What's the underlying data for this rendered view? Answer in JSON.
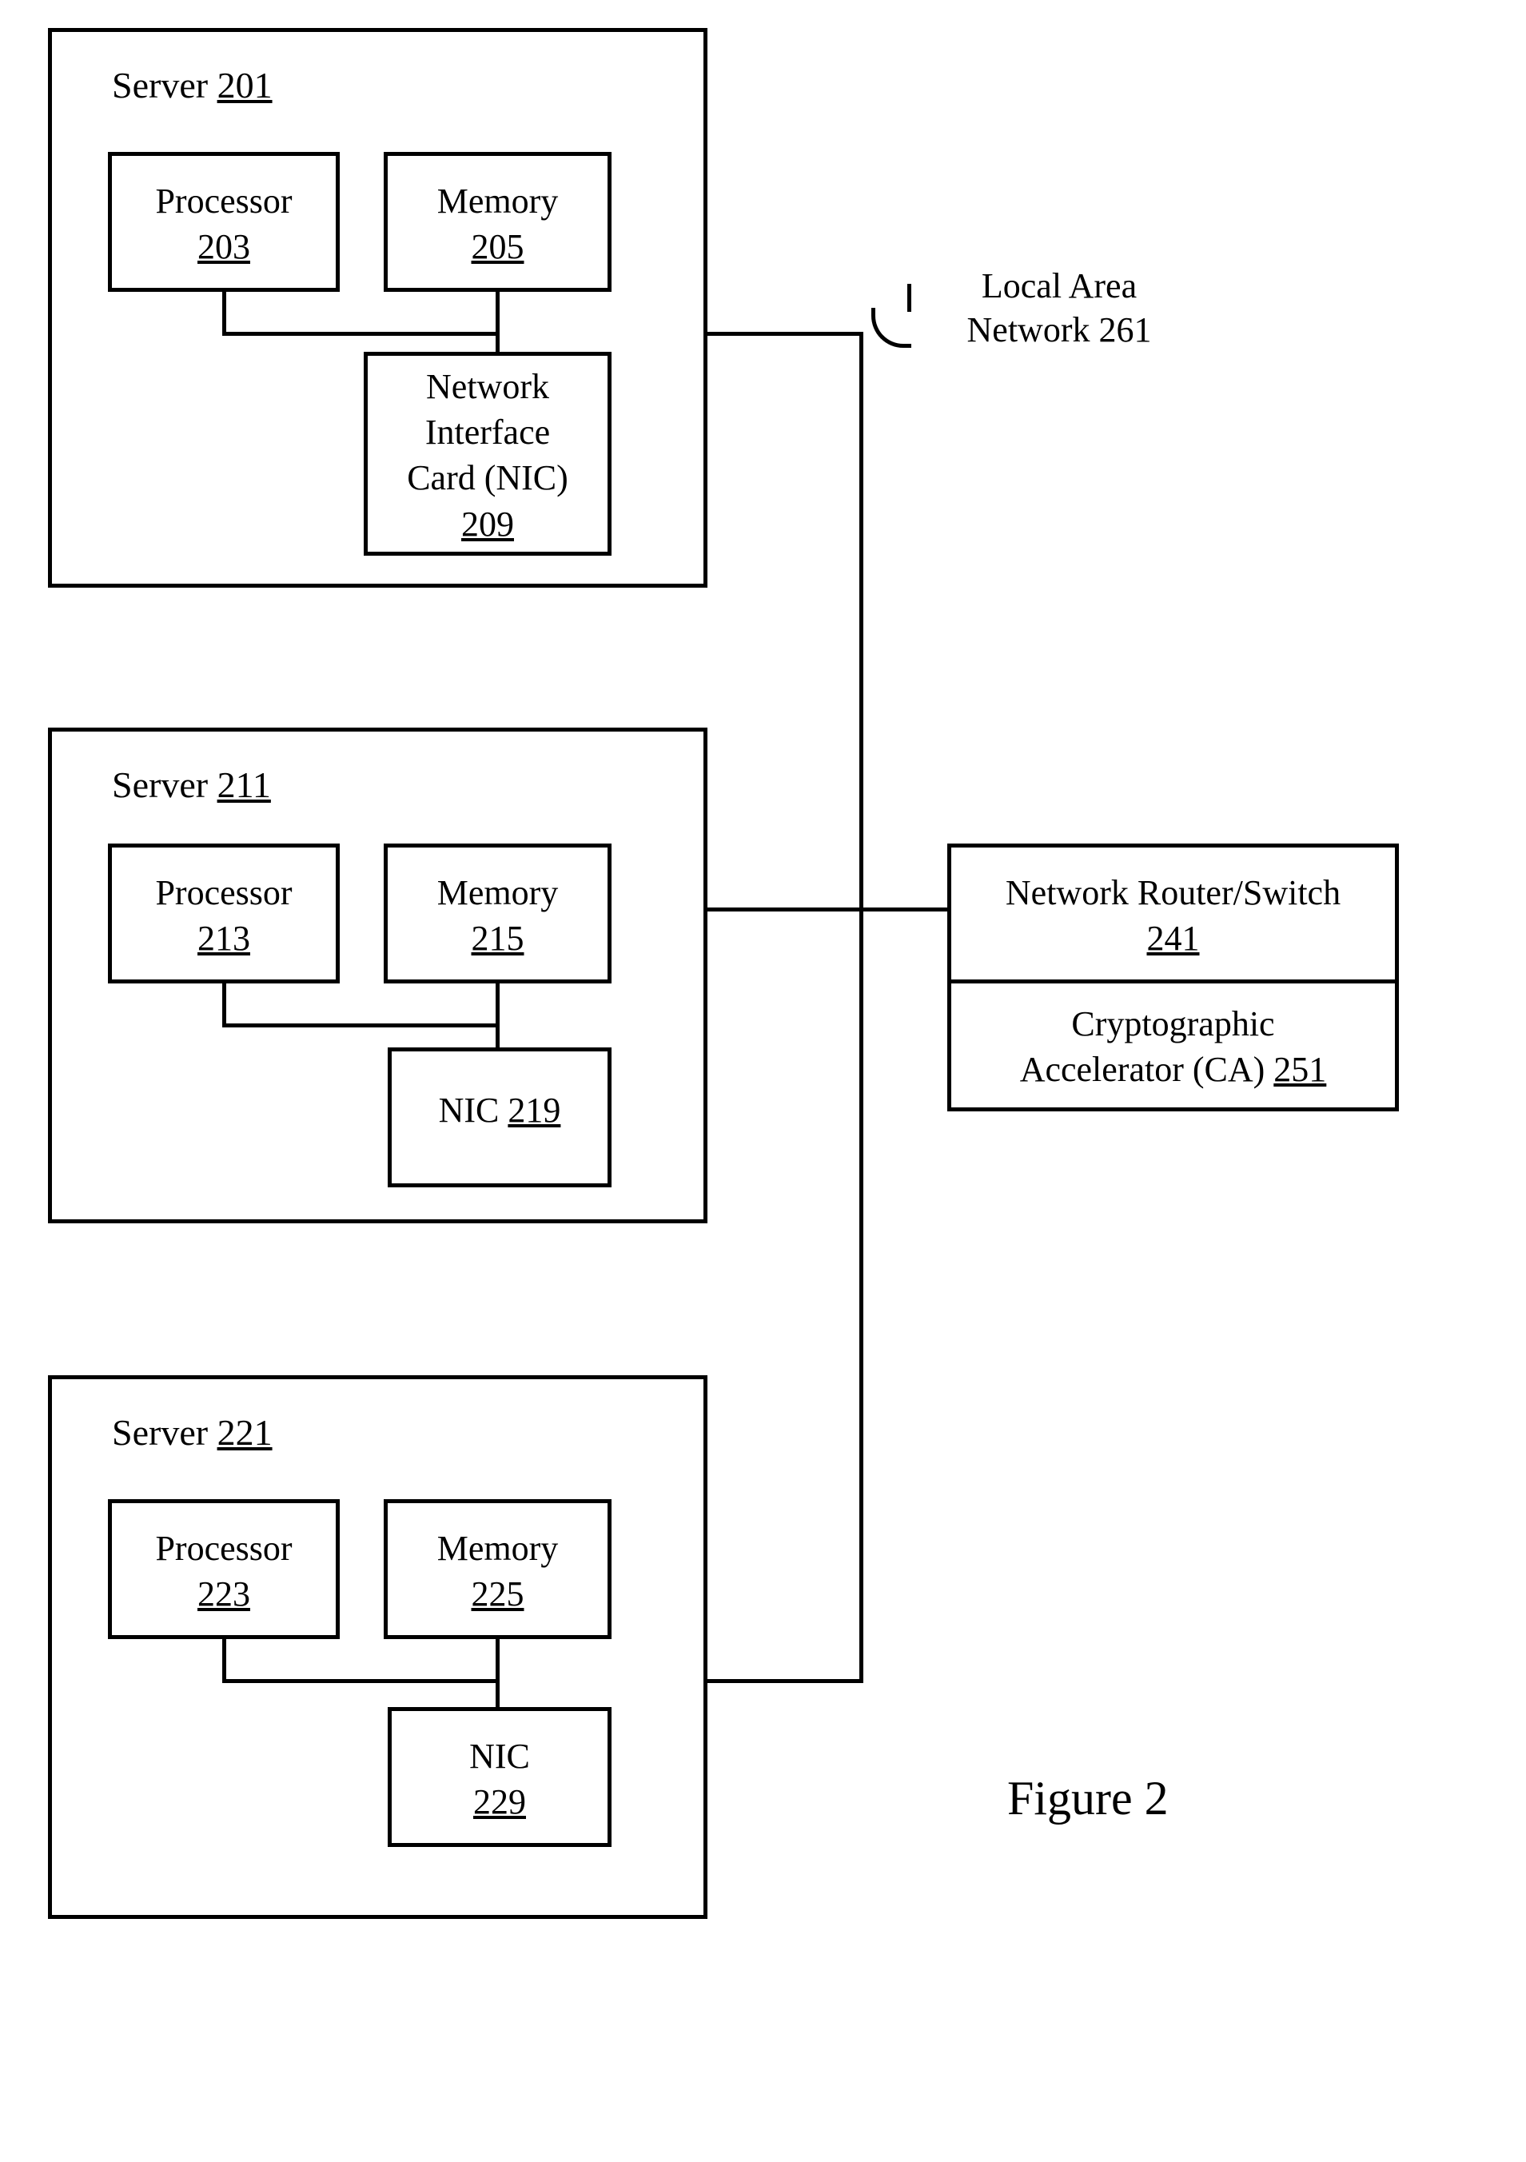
{
  "servers": [
    {
      "title_prefix": "Server ",
      "title_num": "201",
      "processor_prefix": "Processor",
      "processor_num": "203",
      "memory_prefix": "Memory",
      "memory_num": "205",
      "nic_full": "Network",
      "nic_line2": "Interface",
      "nic_line3": "Card (NIC)",
      "nic_num": "209"
    },
    {
      "title_prefix": "Server ",
      "title_num": "211",
      "processor_prefix": "Processor",
      "processor_num": "213",
      "memory_prefix": "Memory",
      "memory_num": "215",
      "nic_label": "NIC ",
      "nic_num": "219"
    },
    {
      "title_prefix": "Server ",
      "title_num": "221",
      "processor_prefix": "Processor",
      "processor_num": "223",
      "memory_prefix": "Memory",
      "memory_num": "225",
      "nic_label": "NIC",
      "nic_num": "229"
    }
  ],
  "lan": {
    "line1": "Local Area",
    "line2": "Network 261"
  },
  "router": {
    "line1": "Network Router/Switch",
    "num": "241"
  },
  "ca": {
    "line1": "Cryptographic",
    "line2_pre": "Accelerator (CA) ",
    "num": "251"
  },
  "figure": "Figure 2"
}
